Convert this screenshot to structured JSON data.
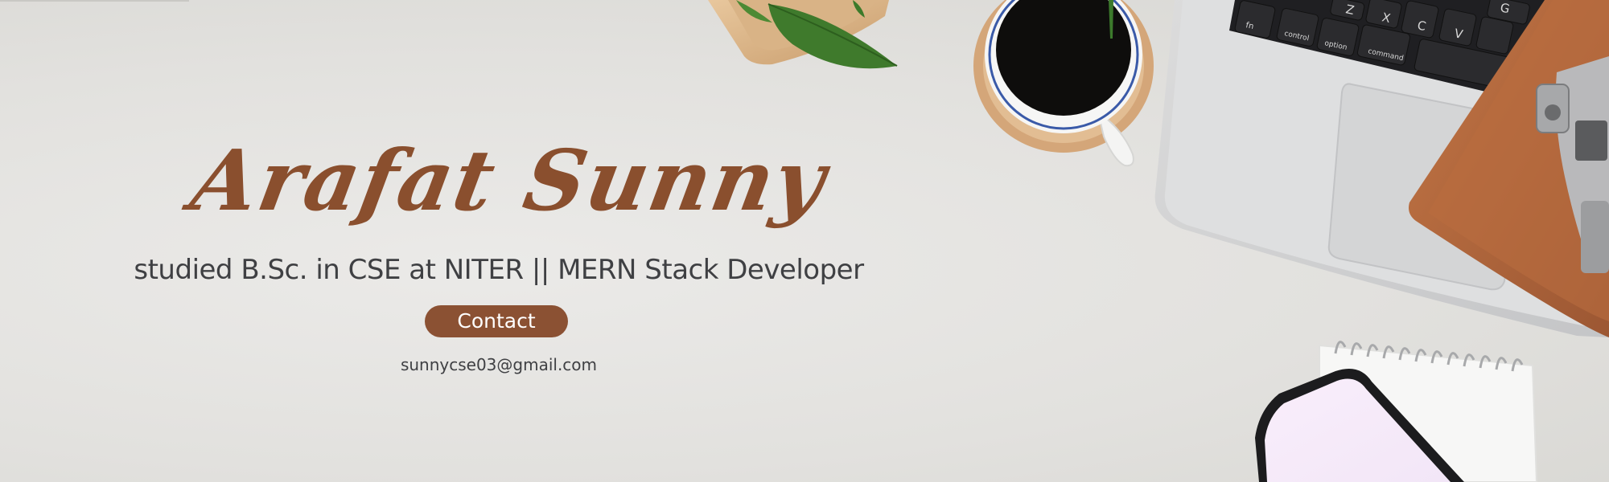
{
  "hero": {
    "name": "Arafat Sunny",
    "subtitle": "studied B.Sc. in CSE at NITER  ||  MERN Stack Developer",
    "contact_label": "Contact",
    "email": "sunnycse03@gmail.com"
  },
  "laptop_keys": [
    "fn",
    "control",
    "option",
    "command",
    "Z",
    "X",
    "C",
    "V",
    "G"
  ],
  "colors": {
    "accent": "#8b5133",
    "name_text": "#8a4f2e",
    "body_text": "#3f4043",
    "background": "#e4e3e0",
    "notebook": "#b86a3f",
    "phone_screen": "#f6ecfa"
  },
  "decor_icons": [
    "plant-leaves",
    "coffee-cup",
    "laptop",
    "leather-notebook",
    "camera",
    "spiral-notepad",
    "smartphone"
  ]
}
